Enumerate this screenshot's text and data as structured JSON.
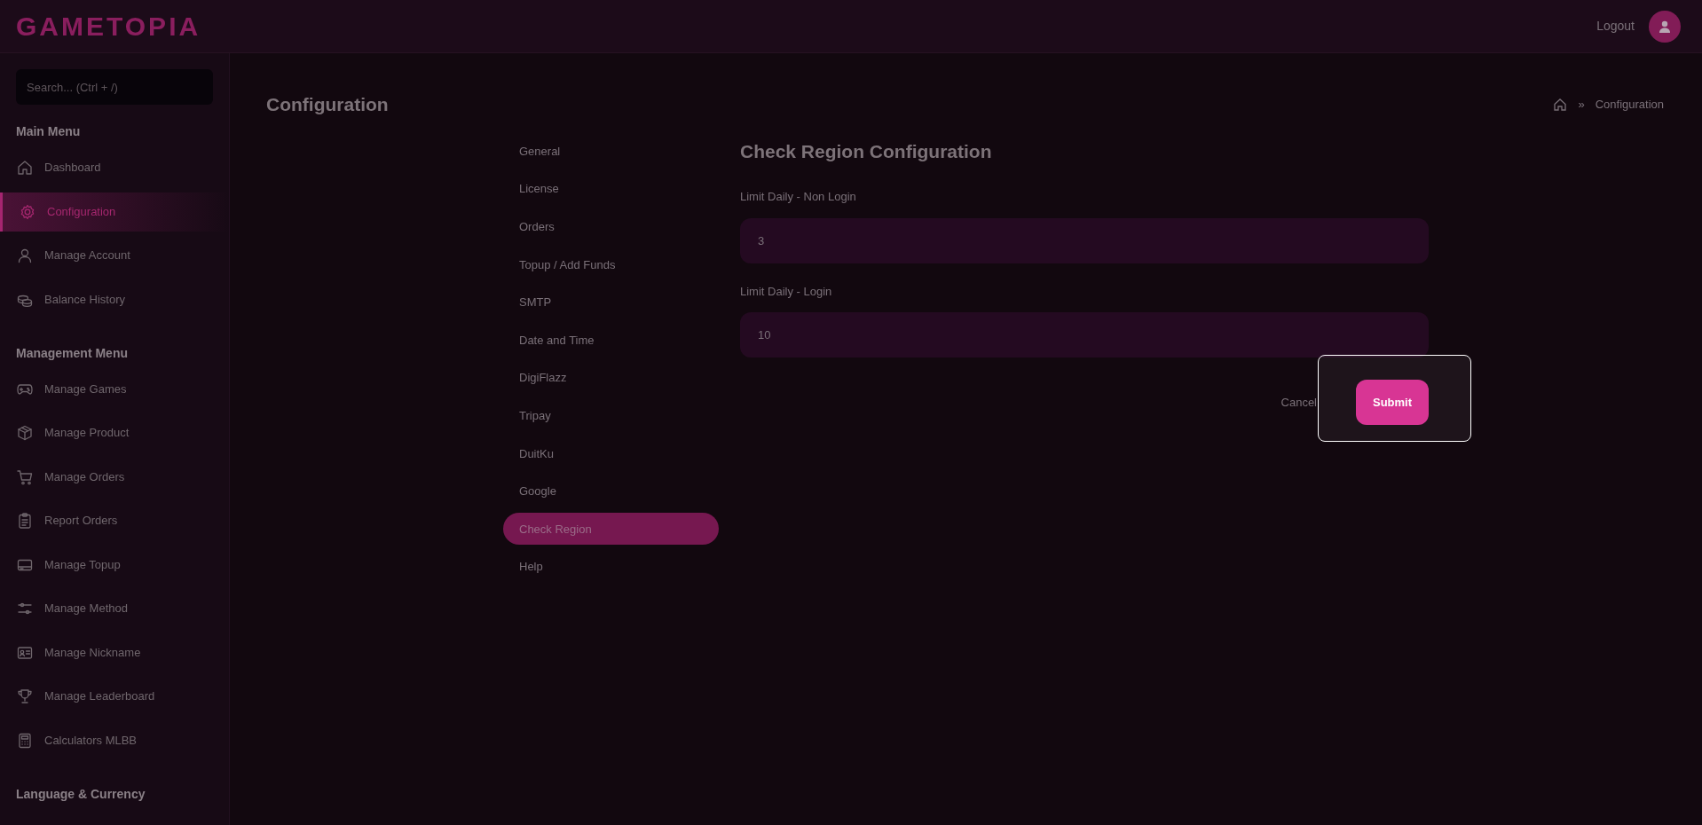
{
  "header": {
    "logo": "GAMETOPIA",
    "logout": "Logout"
  },
  "sidebar": {
    "search": {
      "placeholder": "Search... (Ctrl + /)"
    },
    "sections": [
      {
        "title": "Main Menu",
        "items": [
          {
            "label": "Dashboard",
            "selected": false
          },
          {
            "label": "Configuration",
            "selected": true
          },
          {
            "label": "Manage Account",
            "selected": false
          },
          {
            "label": "Balance History",
            "selected": false
          }
        ]
      },
      {
        "title": "Management Menu",
        "items": [
          {
            "label": "Manage Games",
            "selected": false
          },
          {
            "label": "Manage Product",
            "selected": false
          },
          {
            "label": "Manage Orders",
            "selected": false
          },
          {
            "label": "Report Orders",
            "selected": false
          },
          {
            "label": "Manage Topup",
            "selected": false
          },
          {
            "label": "Manage Method",
            "selected": false
          },
          {
            "label": "Manage Nickname",
            "selected": false
          },
          {
            "label": "Manage Leaderboard",
            "selected": false
          },
          {
            "label": "Calculators MLBB",
            "selected": false
          }
        ]
      },
      {
        "title": "Language & Currency"
      }
    ]
  },
  "page": {
    "title": "Configuration",
    "breadcrumb": {
      "separator": "»",
      "current": "Configuration"
    }
  },
  "config_menu": [
    {
      "label": "General",
      "selected": false
    },
    {
      "label": "License",
      "selected": false
    },
    {
      "label": "Orders",
      "selected": false
    },
    {
      "label": "Topup / Add Funds",
      "selected": false
    },
    {
      "label": "SMTP",
      "selected": false
    },
    {
      "label": "Date and Time",
      "selected": false
    },
    {
      "label": "DigiFlazz",
      "selected": false
    },
    {
      "label": "Tripay",
      "selected": false
    },
    {
      "label": "DuitKu",
      "selected": false
    },
    {
      "label": "Google",
      "selected": false
    },
    {
      "label": "Check Region",
      "selected": true
    },
    {
      "label": "Help",
      "selected": false
    }
  ],
  "form": {
    "title": "Check Region Configuration",
    "fields": [
      {
        "label": "Limit Daily - Non Login",
        "value": "3"
      },
      {
        "label": "Limit Daily - Login",
        "value": "10"
      }
    ],
    "cancel": "Cancel",
    "submit": "Submit",
    "submit_highlighted": true
  }
}
